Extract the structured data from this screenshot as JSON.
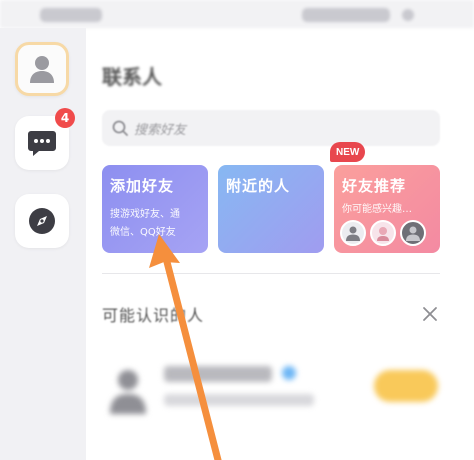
{
  "page": {
    "title": "联系人"
  },
  "search": {
    "placeholder": "搜索好友"
  },
  "sidebar": {
    "items": [
      {
        "name": "contacts",
        "icon": "person-icon",
        "active": true
      },
      {
        "name": "messages",
        "icon": "chat-bubble-icon",
        "badge": "4"
      },
      {
        "name": "discover",
        "icon": "compass-icon"
      }
    ]
  },
  "cards": [
    {
      "title": "添加好友",
      "subtitle_lines": [
        "搜游戏好友、通",
        "微信、QQ好友"
      ]
    },
    {
      "title": "附近的人"
    },
    {
      "title": "好友推荐",
      "subtitle": "你可能感兴趣…",
      "badge": "NEW"
    }
  ],
  "suggestions": {
    "title": "可能认识的人"
  },
  "colors": {
    "sidebar_bg": "#f1f1f4",
    "card_add": "#8d8ff0",
    "card_nearby": "#87b8f2",
    "card_recommend": "#f38aa2",
    "badge_red": "#f04b4b",
    "accent_arrow": "#f58f3d",
    "add_button": "#f9c95a"
  }
}
